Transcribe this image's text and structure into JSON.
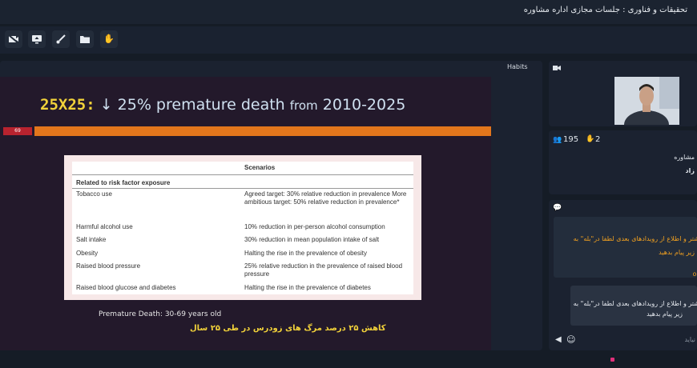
{
  "window": {
    "title": "تحقیقات و فناوری : جلسات مجازی اداره مشاوره"
  },
  "toolbar": {
    "icons": [
      "camera-off-icon",
      "share-screen-icon",
      "brush-icon",
      "folder-icon",
      "raise-hand-icon"
    ]
  },
  "stage": {
    "tab_label": "Habits"
  },
  "slide": {
    "title_prefix": "25X25:",
    "title_arrow": "↓",
    "title_main": " 25% premature death ",
    "title_from": "from",
    "title_years": " 2010-2025",
    "page_number": "69",
    "note": "Premature Death: 30-69 years old",
    "persian_note": "کاهش ۲۵ درصد مرگ های زودرس در طی ۲۵ سال"
  },
  "table": {
    "header": "Scenarios",
    "section": "Related to risk factor exposure",
    "rows": [
      {
        "label": "Tobacco use",
        "value": "Agreed target: 30% relative reduction in prevalence More ambitious target: 50% relative reduction in prevalence*"
      },
      {
        "label": "Harmful alcohol use",
        "value": "10% reduction in per-person alcohol consumption"
      },
      {
        "label": "Salt intake",
        "value": "30% reduction in mean population intake of salt"
      },
      {
        "label": "Obesity",
        "value": "Halting the rise in the prevalence of obesity"
      },
      {
        "label": "Raised blood pressure",
        "value": "25% relative reduction in the prevalence of raised blood pressure"
      },
      {
        "label": "Raised blood glucose and diabetes",
        "value": "Halting the rise in the prevalence of diabetes"
      }
    ]
  },
  "participants": {
    "count": "195",
    "hands": "2",
    "line1": "مشاوره",
    "line2": "زاد"
  },
  "chat": {
    "message1": "بیشتر و اطلاع از رویدادهای بعدی لطفا در\"بله\" به",
    "message1_line2": "زیر پیام بدهید",
    "message1_extra": "ok",
    "message2": "بیشتر و اطلاع از رویدادهای بعدی لطفا در\"بله\" به",
    "message2_line2": "زیر پیام بدهید",
    "input_placeholder": "نیاید"
  },
  "colors": {
    "accent_orange": "#e2761c",
    "accent_red": "#b8232f",
    "title_yellow": "#f2d23a",
    "msg_orange": "#f0a020"
  }
}
